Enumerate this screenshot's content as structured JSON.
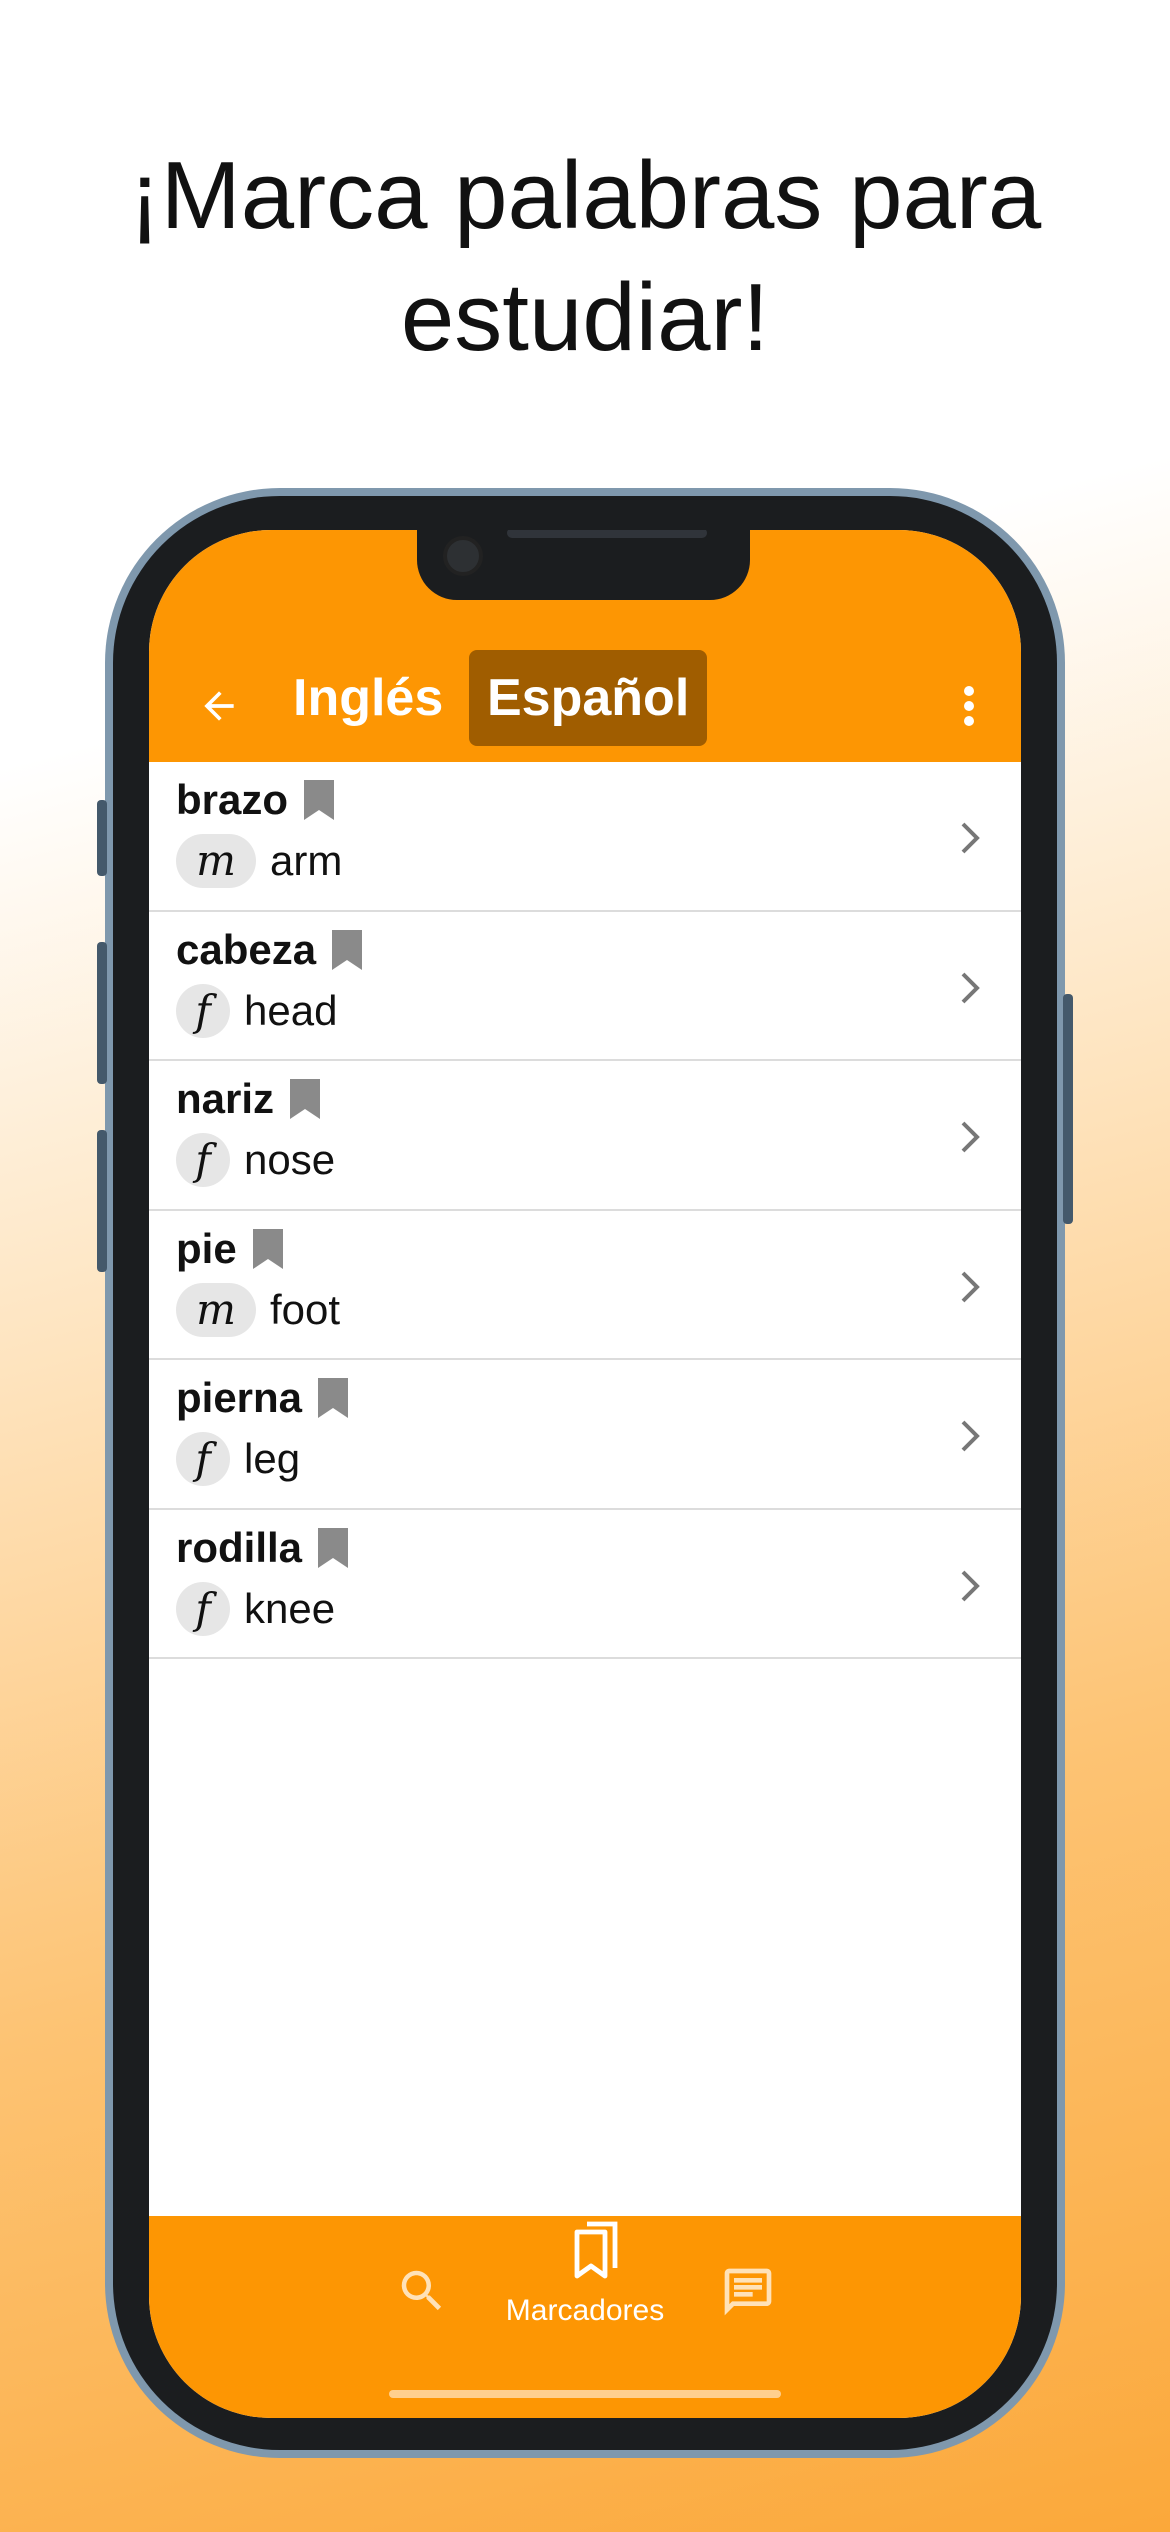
{
  "headline": {
    "line1": "¡Marca palabras para",
    "line2": "estudiar!"
  },
  "colors": {
    "accent": "#fd9603",
    "active_tab": "#a05d00",
    "bookmark": "#8a8a8a",
    "gender_chip": "#e6e6e6"
  },
  "appbar": {
    "back_icon": "arrow-left-icon",
    "lang_source": "Inglés",
    "lang_target": "Español",
    "menu_icon": "more-vertical-icon"
  },
  "words": [
    {
      "word": "brazo",
      "gender": "m",
      "translation": "arm"
    },
    {
      "word": "cabeza",
      "gender": "f",
      "translation": "head"
    },
    {
      "word": "nariz",
      "gender": "f",
      "translation": "nose"
    },
    {
      "word": "pie",
      "gender": "m",
      "translation": "foot"
    },
    {
      "word": "pierna",
      "gender": "f",
      "translation": "leg"
    },
    {
      "word": "rodilla",
      "gender": "f",
      "translation": "knee"
    }
  ],
  "bottom_nav": {
    "search_icon": "search-icon",
    "bookmarks_icon": "bookmarks-icon",
    "bookmarks_label": "Marcadores",
    "feedback_icon": "feedback-icon"
  }
}
